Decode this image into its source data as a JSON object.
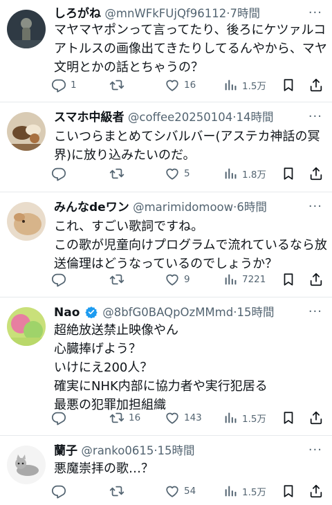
{
  "tweets": [
    {
      "name": "しろがね",
      "handle": "@mnWFkFUjQf96112",
      "time": "·7時間",
      "lines": [
        "マヤマヤポンって言ってたり、後ろにケツァルコ",
        "アトルスの画像出てきたりしてるんやから、マヤ",
        "文明とかの話とちゃうの？"
      ],
      "reply": "1",
      "retweet": "",
      "like": "16",
      "views": "1.5万"
    },
    {
      "name": "スマホ中級者",
      "handle": "@coffee20250104",
      "time": "·14時間",
      "lines": [
        "こいつらまとめてシバルバー(アステカ神話の冥",
        "界)に放り込みたいのだ。"
      ],
      "reply": "",
      "retweet": "",
      "like": "5",
      "views": "1.8万"
    },
    {
      "name": "みんなdeワン",
      "handle": "@marimidomoow",
      "time": "·6時間",
      "lines": [
        "これ、すごい歌詞ですね。",
        "この歌が児童向けプログラムで流れているなら放",
        "送倫理はどうなっているのでしょうか？"
      ],
      "reply": "",
      "retweet": "",
      "like": "9",
      "views": "7221"
    },
    {
      "name": "Nao",
      "handle": "@8bfG0BAQpOzMMmd",
      "time": "·15時間",
      "lines": [
        "超絶放送禁止映像やん",
        "心臓捧げよう？",
        "いけにえ200人？",
        "確実にNHK内部に協力者や実行犯居る",
        "最悪の犯罪加担組織"
      ],
      "reply": "",
      "retweet": "16",
      "like": "143",
      "views": "1.5万"
    },
    {
      "name": "蘭子",
      "handle": "@ranko0615",
      "time": "·15時間",
      "lines": [
        "悪魔崇拝の歌…？"
      ],
      "reply": "",
      "retweet": "",
      "like": "54",
      "views": "1.5万"
    }
  ],
  "more_label": "···",
  "colors": {
    "text": "#0f1419",
    "secondary": "#536471",
    "verified": "#1d9bf0",
    "divider": "#e6e9ec"
  },
  "icons": [
    "reply-icon",
    "retweet-icon",
    "like-icon",
    "views-icon",
    "bookmark-icon",
    "share-icon",
    "verified-badge-icon",
    "more-icon"
  ]
}
